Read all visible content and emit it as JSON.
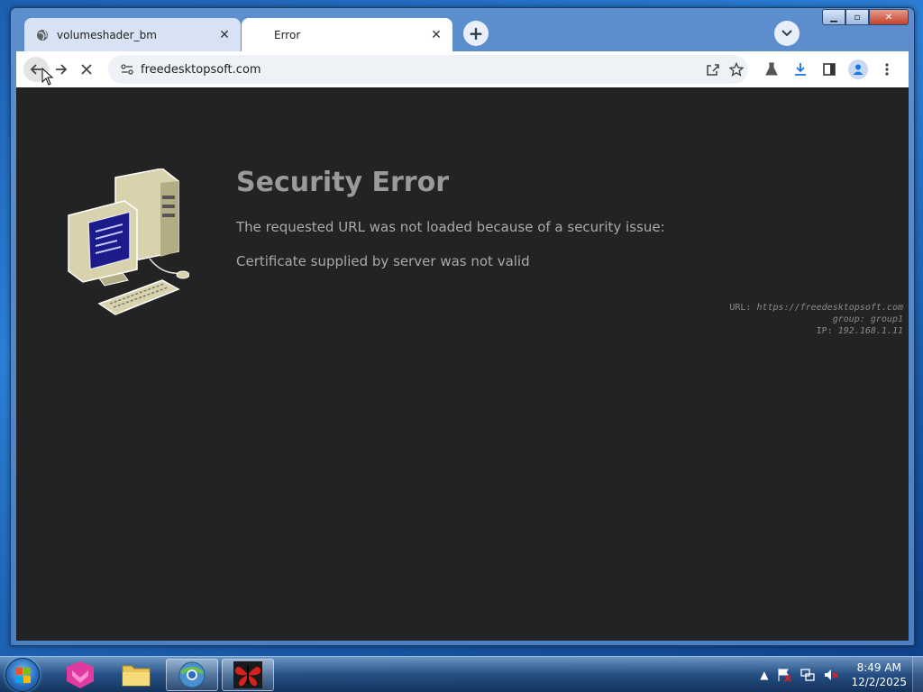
{
  "tabs": [
    {
      "title": "volumeshader_bm",
      "favicon": "globe-icon",
      "active": false
    },
    {
      "title": "Error",
      "favicon": "none",
      "active": true
    }
  ],
  "toolbar": {
    "url": "freedesktopsoft.com"
  },
  "page": {
    "heading": "Security Error",
    "message": "The requested URL was not loaded because of a security issue:",
    "detail": "Certificate supplied by server was not valid",
    "info_url_label": "URL:",
    "info_url_value": "https://freedesktopsoft.com",
    "info_group_label": "group:",
    "info_group_value": "group1",
    "info_ip_label": "IP:",
    "info_ip_value": "192.168.1.11"
  },
  "taskbar": {
    "time": "8:49 AM",
    "date": "12/2/2025"
  },
  "colors": {
    "content_bg": "#232323",
    "heading": "#9a9a9a",
    "tab_active": "#ffffff",
    "tab_inactive": "#d7e3f5"
  }
}
